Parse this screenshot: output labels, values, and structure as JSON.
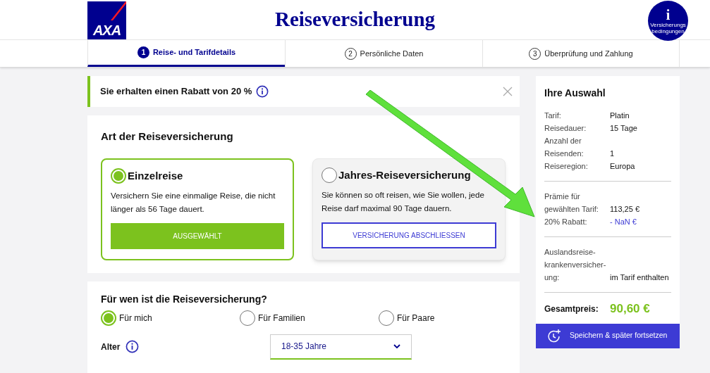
{
  "header": {
    "logo": "AXA",
    "title": "Reiseversicherung",
    "info_button": {
      "icon": "i",
      "label": "Versicherungs bedingungen"
    }
  },
  "steps": [
    {
      "number": "1",
      "label": "Reise- und Tarifdetails",
      "selected": true
    },
    {
      "number": "2",
      "label": "Persönliche Daten",
      "selected": false
    },
    {
      "number": "3",
      "label": "Überprüfung und Zahlung",
      "selected": false
    }
  ],
  "notice": {
    "text": "Sie erhalten einen Rabatt von 20 %"
  },
  "insurance_type": {
    "heading": "Art der Reiseversicherung",
    "options": [
      {
        "title": "Einzelreise",
        "description": "Versichern Sie eine einmalige Reise, die nicht länger als 56 Tage dauert.",
        "button": "AUSGEWÄHLT",
        "selected": true
      },
      {
        "title": "Jahres-Reiseversicherung",
        "description": "Sie können so oft reisen, wie Sie wollen, jede Reise darf maximal 90 Tage dauern.",
        "button": "VERSICHERUNG ABSCHLIESSEN",
        "selected": false
      }
    ]
  },
  "travelers": {
    "heading": "Für wen ist die Reiseversicherung?",
    "options": [
      {
        "label": "Für mich",
        "selected": true
      },
      {
        "label": "Für Familien",
        "selected": false
      },
      {
        "label": "Für Paare",
        "selected": false
      }
    ],
    "fields": [
      {
        "label": "Alter",
        "value": "18-35 Jahre"
      }
    ]
  },
  "summary": {
    "title": "Ihre Auswahl",
    "sections": [
      [
        {
          "label": "Tarif:",
          "value": "Platin",
          "kind": "normal"
        },
        {
          "label": "Reisedauer:",
          "value": "15 Tage",
          "kind": "normal"
        },
        {
          "label": "Anzahl der Reisenden:",
          "value": "1",
          "kind": "normal"
        },
        {
          "label": "Reiseregion:",
          "value": "Europa",
          "kind": "normal"
        }
      ],
      [
        {
          "label": "Prämie für gewählten Tarif:",
          "value": "113,25 €",
          "kind": "normal"
        },
        {
          "label": "20% Rabatt:",
          "value": "- NaN €",
          "kind": "discount"
        }
      ],
      [
        {
          "label": "Auslandsreise-krankenversicher-ung:",
          "value": "im Tarif enthalten",
          "kind": "normal"
        }
      ]
    ],
    "total_label": "Gesamtpreis:",
    "total_value": "90,60 €",
    "save_button": "Speichern & später fortsetzen"
  }
}
